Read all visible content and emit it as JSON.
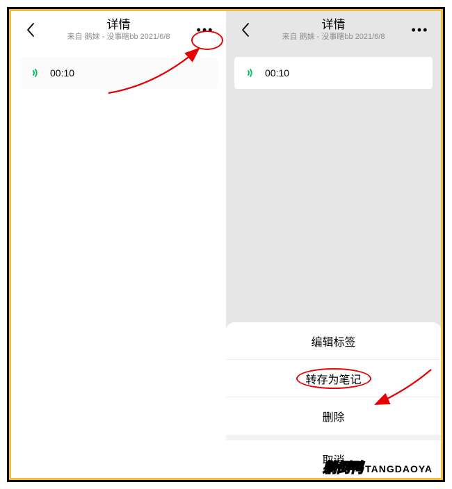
{
  "header": {
    "title": "详情",
    "subtitle": "来自 鹅妹 - 没事瞎bb 2021/6/8"
  },
  "voice": {
    "duration": "00:10"
  },
  "actionsheet": {
    "items": [
      "编辑标签",
      "转存为笔记",
      "删除"
    ],
    "cancel": "取消"
  },
  "watermark": {
    "logo": "躺倒鸭",
    "text": "TANGDAOYA"
  }
}
